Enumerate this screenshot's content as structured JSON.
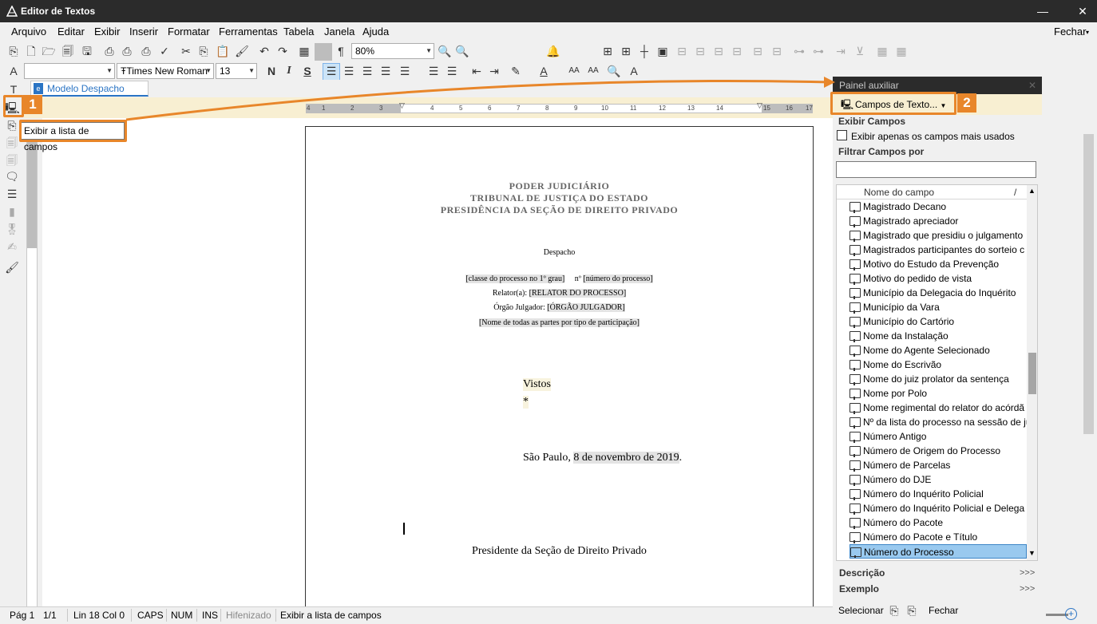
{
  "window": {
    "title": "Editor de Textos",
    "minimize": "—",
    "close": "✕"
  },
  "menu": {
    "items": [
      "Arquivo",
      "Editar",
      "Exibir",
      "Inserir",
      "Formatar",
      "Ferramentas",
      "Tabela",
      "Janela",
      "Ajuda"
    ],
    "close_label": "Fechar"
  },
  "toolbar": {
    "zoom": "80%",
    "font": "Times New Roman",
    "font_size": "13",
    "bold": "N",
    "italic": "I",
    "underline": "S"
  },
  "tab": {
    "label": "Modelo Despacho Cível"
  },
  "tooltip": {
    "text": "Exibir a lista de campos"
  },
  "callouts": [
    "1",
    "2"
  ],
  "ruler": {
    "ticks": [
      "4",
      "1",
      "2",
      "3",
      "4",
      "5",
      "6",
      "7",
      "8",
      "9",
      "10",
      "11",
      "12",
      "13",
      "14",
      "15",
      "16",
      "17"
    ]
  },
  "document": {
    "header": [
      "PODER JUDICIÁRIO",
      "TRIBUNAL DE JUSTIÇA DO ESTADO",
      "PRESIDÊNCIA DA SEÇÃO DE DIREITO PRIVADO"
    ],
    "despacho": "Despacho",
    "classe": "[classe do processo no 1º grau]",
    "numero_prefix": "nº",
    "numero": "[número do processo]",
    "relator_label": "Relator(a):",
    "relator": "[RELATOR DO PROCESSO]",
    "orgao_label": "Órgão Julgador:",
    "orgao": "[ÓRGÃO JULGADOR]",
    "partes": "[Nome de todas as partes por tipo de participação]",
    "vistos": "Vistos",
    "asterisk": "*",
    "city": "São Paulo,",
    "date": "8 de novembro de 2019",
    "date_suffix": ".",
    "signature": "Presidente da Seção de Direito Privado"
  },
  "panel": {
    "title": "Painel auxiliar",
    "dropdown": "Campos de Texto...",
    "section_exibir": "Exibir Campos",
    "checkbox_label": "Exibir apenas os campos mais usados",
    "section_filtrar": "Filtrar Campos por",
    "filter_value": "",
    "column_header": "Nome do campo",
    "column_sort": "/",
    "fields": [
      "Magistrado Decano",
      "Magistrado apreciador",
      "Magistrado que presidiu o julgamento",
      "Magistrados participantes do sorteio c",
      "Motivo do Estudo da Prevenção",
      "Motivo do pedido de vista",
      "Município da Delegacia do Inquérito",
      "Município da Vara",
      "Município do Cartório",
      "Nome da Instalação",
      "Nome do Agente Selecionado",
      "Nome do Escrivão",
      "Nome do juiz prolator da sentença",
      "Nome por Polo",
      "Nome regimental do relator do acórdã",
      "Nº da lista do processo na sessão de ju",
      "Número Antigo",
      "Número de Origem do Processo",
      "Número de Parcelas",
      "Número do DJE",
      "Número do Inquérito Policial",
      "Número do Inquérito Policial e Delega",
      "Número do Pacote",
      "Número do Pacote e Título",
      "Número do Processo"
    ],
    "selected_field": "Número do Processo",
    "descricao": "Descrição",
    "exemplo": "Exemplo",
    "more": ">>>",
    "selecionar": "Selecionar",
    "fechar": "Fechar"
  },
  "status": {
    "page": "Pág 1",
    "pages": "1/1",
    "line_col": "Lin 18  Col 0",
    "caps": "CAPS",
    "num": "NUM",
    "ins": "INS",
    "hifen": "Hifenizado",
    "message": "Exibir a lista de campos"
  },
  "colors": {
    "accent": "#e8862a",
    "tab": "#2a74c4",
    "selection": "#99c9ef"
  }
}
